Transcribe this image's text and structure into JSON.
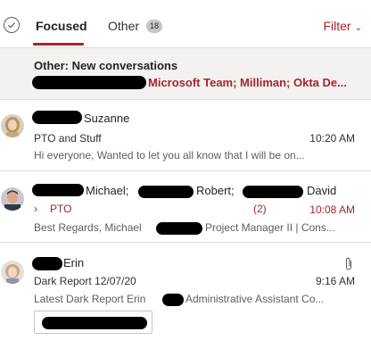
{
  "header": {
    "tabs": [
      {
        "label": "Focused",
        "active": true
      },
      {
        "label": "Other",
        "count": "18",
        "active": false
      }
    ],
    "filter_label": "Filter",
    "accent_color": "#a4262c"
  },
  "banner": {
    "title": "Other: New conversations",
    "senders": "Microsoft Team; Milliman; Okta De..."
  },
  "messages": [
    {
      "sender": "Suzanne",
      "subject": "PTO and Stuff",
      "time": "10:20 AM",
      "preview": "Hi everyone, Wanted to let you all know that I will be on..."
    },
    {
      "sender_parts": [
        "Michael;",
        "Robert;",
        "David"
      ],
      "subject": "PTO",
      "thread_count": "(2)",
      "time": "10:08 AM",
      "preview_start": "Best Regards, Michael",
      "preview_end": "Project Manager II | Cons..."
    },
    {
      "sender": "Erin",
      "subject": "Dark Report 12/07/20",
      "time": "9:16 AM",
      "preview_start": "Latest Dark Report Erin",
      "preview_end": "Administrative Assistant Co...",
      "has_attachment": true
    }
  ]
}
